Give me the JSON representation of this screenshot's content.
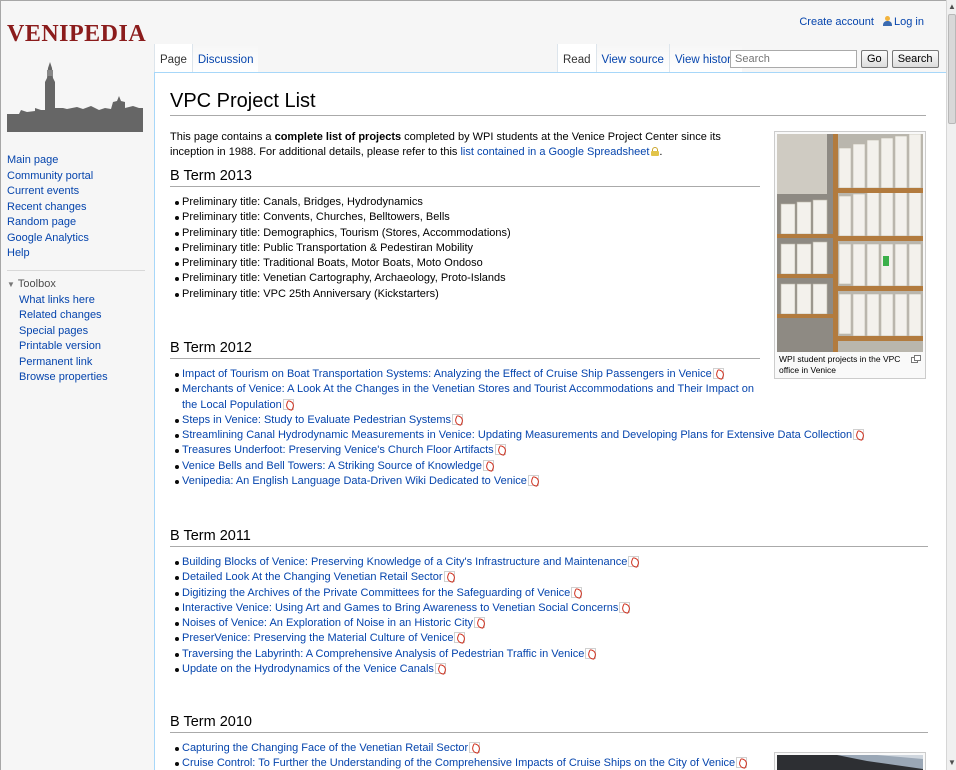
{
  "site": {
    "wordmark": "VENIPEDIA"
  },
  "personal": {
    "create_account": "Create account",
    "log_in": "Log in"
  },
  "nav": {
    "items": [
      "Main page",
      "Community portal",
      "Current events",
      "Recent changes",
      "Random page",
      "Google Analytics",
      "Help"
    ],
    "toolbox_label": "Toolbox",
    "toolbox_items": [
      "What links here",
      "Related changes",
      "Special pages",
      "Printable version",
      "Permanent link",
      "Browse properties"
    ]
  },
  "tabs": {
    "page": "Page",
    "discussion": "Discussion",
    "read": "Read",
    "view_source": "View source",
    "view_history": "View history"
  },
  "search": {
    "placeholder": "Search",
    "go": "Go",
    "search_button": "Search"
  },
  "article": {
    "title": "VPC Project List",
    "intro_1": "This page contains a ",
    "intro_bold": "complete list of projects",
    "intro_2": " completed by WPI students at the Venice Project Center since its inception in 1988. For additional details, please refer to this ",
    "intro_link": "list contained in a Google Spreadsheet",
    "intro_3": "."
  },
  "thumb": {
    "caption": "WPI student projects in the VPC office in Venice"
  },
  "sections": [
    {
      "heading": "B Term 2013",
      "items": [
        "Preliminary title: Canals, Bridges, Hydrodynamics",
        "Preliminary title: Convents, Churches, Belltowers, Bells",
        "Preliminary title: Demographics, Tourism (Stores, Accommodations)",
        "Preliminary title: Public Transportation & Pedestiran Mobility",
        "Preliminary title: Traditional Boats, Motor Boats, Moto Ondoso",
        "Preliminary title: Venetian Cartography, Archaeology, Proto-Islands",
        "Preliminary title: VPC 25th Anniversary (Kickstarters)"
      ]
    },
    {
      "heading": "B Term 2012",
      "items": [
        "Impact of Tourism on Boat Transportation Systems: Analyzing the Effect of Cruise Ship Passengers in Venice",
        "Merchants of Venice: A Look At the Changes in the Venetian Stores and Tourist Accommodations and Their Impact on the Local Population",
        "Steps in Venice: Study to Evaluate Pedestrian Systems",
        "Streamlining Canal Hydrodynamic Measurements in Venice: Updating Measurements and Developing Plans for Extensive Data Collection",
        "Treasures Underfoot: Preserving Venice's Church Floor Artifacts",
        "Venice Bells and Bell Towers: A Striking Source of Knowledge",
        "Venipedia: An English Language Data-Driven Wiki Dedicated to Venice"
      ]
    },
    {
      "heading": "B Term 2011",
      "items": [
        "Building Blocks of Venice: Preserving Knowledge of a City's Infrastructure and Maintenance",
        "Detailed Look At the Changing Venetian Retail Sector",
        "Digitizing the Archives of the Private Committees for the Safeguarding of Venice",
        "Interactive Venice: Using Art and Games to Bring Awareness to Venetian Social Concerns",
        "Noises of Venice: An Exploration of Noise in an Historic City",
        "PreserVenice: Preserving the Material Culture of Venice",
        "Traversing the Labyrinth: A Comprehensive Analysis of Pedestrian Traffic in Venice",
        "Update on the Hydrodynamics of the Venice Canals"
      ]
    },
    {
      "heading": "B Term 2010",
      "items": [
        "Capturing the Changing Face of the Venetian Retail Sector",
        "Cruise Control: To Further the Understanding of the Comprehensive Impacts of Cruise Ships on the City of Venice"
      ]
    }
  ]
}
